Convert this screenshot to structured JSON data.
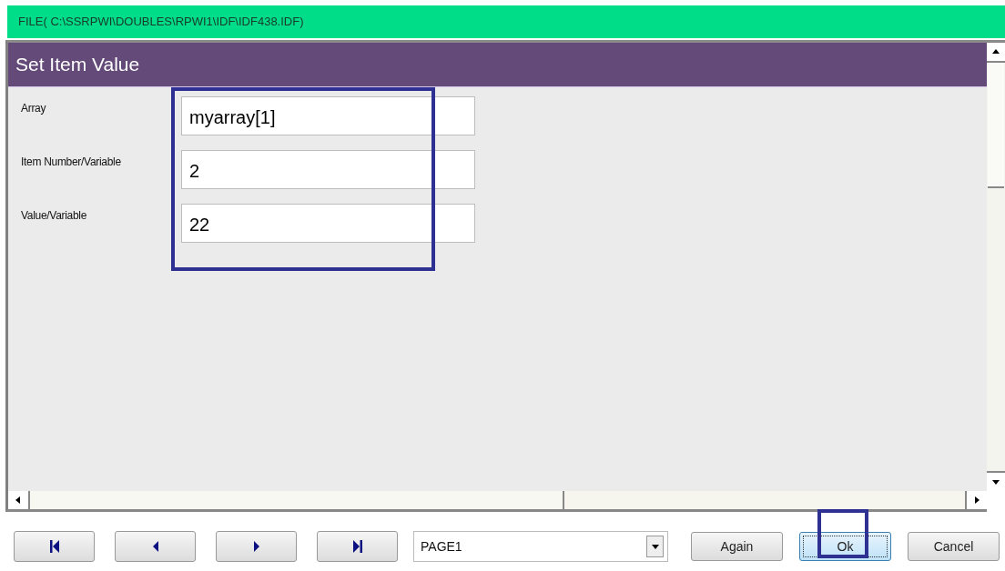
{
  "file_path": "FILE( C:\\SSRPWI\\DOUBLES\\RPWI1\\IDF\\IDF438.IDF)",
  "dialog": {
    "title": "Set Item Value",
    "fields_highlighted": true,
    "fields": [
      {
        "label": "Array",
        "value": "myarray[1]"
      },
      {
        "label": "Item Number/Variable",
        "value": "2"
      },
      {
        "label": "Value/Variable",
        "value": "22"
      }
    ]
  },
  "nav_buttons": [
    {
      "kind": "first"
    },
    {
      "kind": "prev"
    },
    {
      "kind": "next"
    },
    {
      "kind": "last"
    }
  ],
  "page_select": {
    "value": "PAGE1"
  },
  "action_buttons": [
    {
      "label": "Again",
      "default": false,
      "highlighted": false
    },
    {
      "label": "Ok",
      "default": true,
      "highlighted": true
    },
    {
      "label": "Cancel",
      "default": false,
      "highlighted": false
    }
  ]
}
